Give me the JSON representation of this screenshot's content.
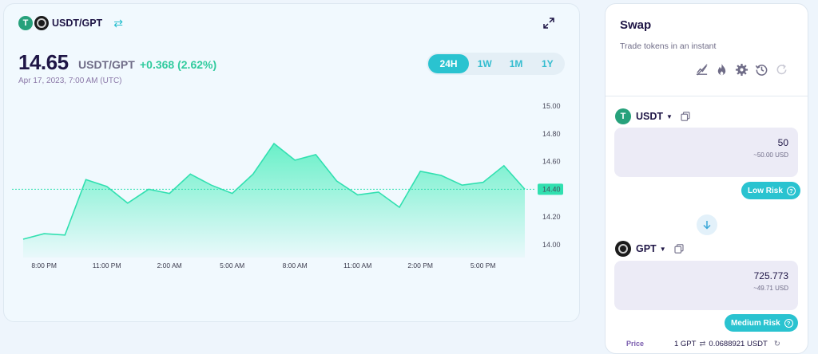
{
  "chart_header": {
    "pair": "USDT/GPT",
    "price": "14.65",
    "price_pair": "USDT/GPT",
    "change": "+0.368 (2.62%)",
    "date": "Apr 17, 2023, 7:00 AM (UTC)",
    "ranges": [
      "24H",
      "1W",
      "1M",
      "1Y"
    ],
    "active_range": "24H"
  },
  "chart_data": {
    "type": "area",
    "x": [
      "7:00 PM",
      "8:00 PM",
      "9:00 PM",
      "10:00 PM",
      "11:00 PM",
      "12:00 AM",
      "1:00 AM",
      "2:00 AM",
      "3:00 AM",
      "4:00 AM",
      "5:00 AM",
      "6:00 AM",
      "7:00 AM",
      "8:00 AM",
      "9:00 AM",
      "10:00 AM",
      "11:00 AM",
      "12:00 PM",
      "1:00 PM",
      "2:00 PM",
      "3:00 PM",
      "4:00 PM",
      "5:00 PM",
      "6:00 PM",
      "7:00 PM"
    ],
    "values": [
      14.04,
      14.08,
      14.07,
      14.47,
      14.42,
      14.3,
      14.4,
      14.37,
      14.51,
      14.43,
      14.37,
      14.51,
      14.73,
      14.61,
      14.65,
      14.46,
      14.36,
      14.38,
      14.27,
      14.53,
      14.5,
      14.43,
      14.45,
      14.57,
      14.4
    ],
    "x_tick_labels": [
      "8:00 PM",
      "11:00 PM",
      "2:00 AM",
      "5:00 AM",
      "8:00 AM",
      "11:00 AM",
      "2:00 PM",
      "5:00 PM"
    ],
    "y_tick_labels": [
      "15.00",
      "14.80",
      "14.60",
      "14.40",
      "14.20",
      "14.00"
    ],
    "current_value_label": "14.40",
    "current_value": 14.4,
    "ylim": [
      14.0,
      15.0
    ],
    "grid": false,
    "line_color": "#31e0b0",
    "fill_color": "#5aefc2"
  },
  "swap": {
    "title": "Swap",
    "subtitle": "Trade tokens in an instant",
    "from": {
      "symbol": "USDT",
      "amount": "50",
      "usd": "~50.00 USD",
      "risk": "Low Risk"
    },
    "to": {
      "symbol": "GPT",
      "amount": "725.773",
      "usd": "~49.71 USD",
      "risk": "Medium Risk"
    },
    "price_label": "Price",
    "price_rate_left": "1 GPT",
    "price_rate_right": "0.0688921 USDT"
  },
  "colors": {
    "accent": "#2ac3d0",
    "positive": "#31cb9e",
    "text": "#1f1646"
  }
}
